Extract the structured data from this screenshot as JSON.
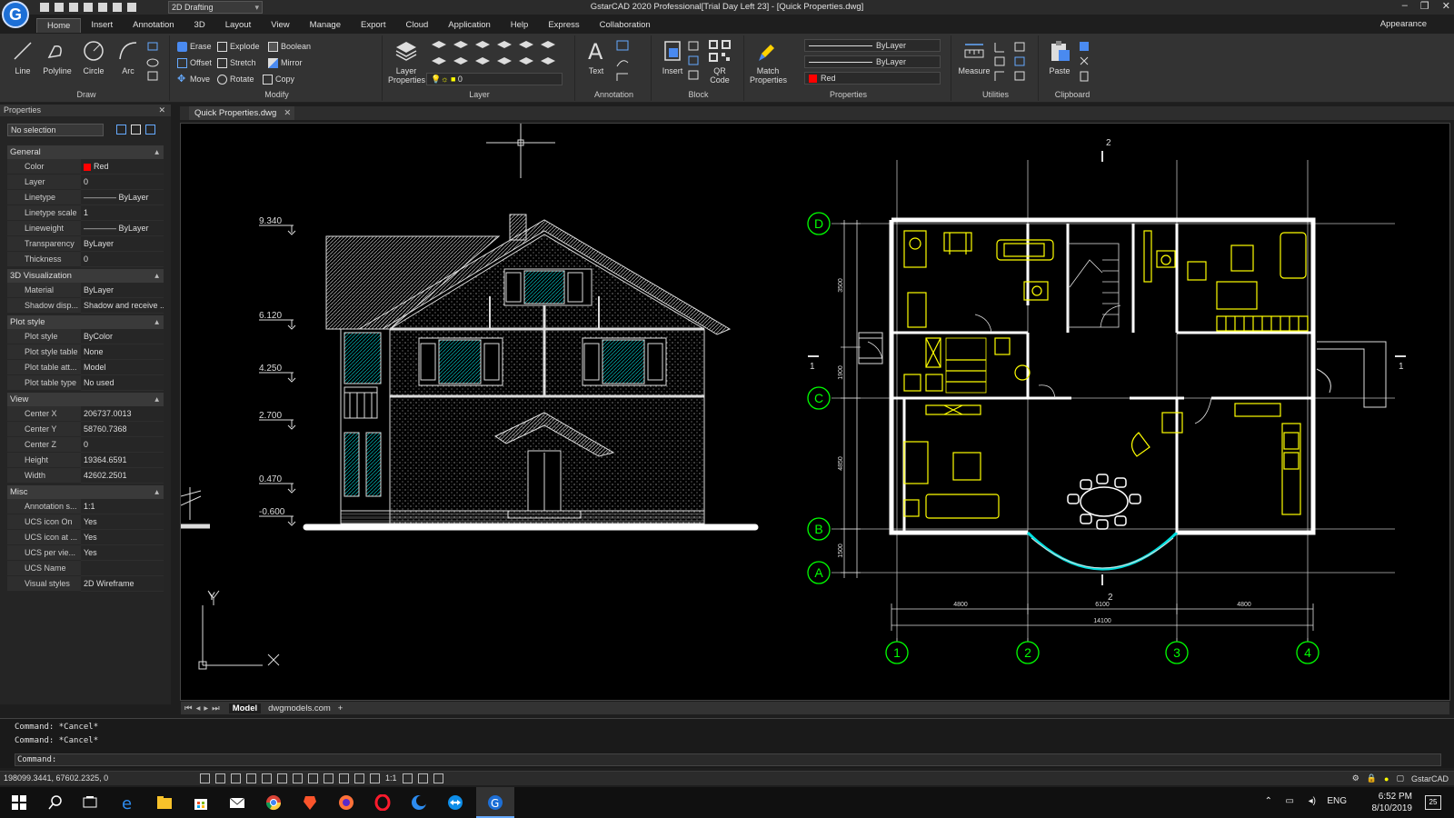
{
  "title_bar": {
    "window_title": "GstarCAD 2020 Professional[Trial Day Left 23] - [Quick Properties.dwg]",
    "workspace": "2D Drafting",
    "logo_letter": "G",
    "controls": [
      "–",
      "❐",
      "✕"
    ]
  },
  "menu": {
    "tabs": [
      "Home",
      "Insert",
      "Annotation",
      "3D",
      "Layout",
      "View",
      "Manage",
      "Export",
      "Cloud",
      "Application",
      "Help",
      "Express",
      "Collaboration"
    ],
    "active": "Home",
    "appearance": "Appearance"
  },
  "ribbon": {
    "draw": {
      "label": "Draw",
      "line": "Line",
      "polyline": "Polyline",
      "circle": "Circle",
      "arc": "Arc"
    },
    "modify": {
      "label": "Modify",
      "erase": "Erase",
      "explode": "Explode",
      "boolean": "Boolean",
      "offset": "Offset",
      "stretch": "Stretch",
      "mirror": "Mirror",
      "move": "Move",
      "rotate": "Rotate",
      "copy": "Copy"
    },
    "layer": {
      "label": "Layer",
      "layer_properties": "Layer Properties",
      "current_layer": "0"
    },
    "annotation": {
      "label": "Annotation",
      "text": "Text"
    },
    "block": {
      "label": "Block",
      "insert": "Insert",
      "qr_code": "QR Code"
    },
    "properties": {
      "label": "Properties",
      "match_properties": "Match Properties",
      "linetype": "ByLayer",
      "lineweight": "ByLayer",
      "color": "Red"
    },
    "utilities": {
      "label": "Utilities",
      "measure": "Measure"
    },
    "clipboard": {
      "label": "Clipboard",
      "paste": "Paste"
    }
  },
  "properties_panel": {
    "title": "Properties",
    "selection": "No selection",
    "sections": [
      {
        "name": "General",
        "rows": [
          {
            "k": "Color",
            "v": "Red"
          },
          {
            "k": "Layer",
            "v": "0"
          },
          {
            "k": "Linetype",
            "v": "———— ByLayer"
          },
          {
            "k": "Linetype scale",
            "v": "1"
          },
          {
            "k": "Lineweight",
            "v": "———— ByLayer"
          },
          {
            "k": "Transparency",
            "v": "ByLayer"
          },
          {
            "k": "Thickness",
            "v": "0"
          }
        ]
      },
      {
        "name": "3D Visualization",
        "rows": [
          {
            "k": "Material",
            "v": "ByLayer"
          },
          {
            "k": "Shadow disp...",
            "v": "Shadow and receive ..."
          }
        ]
      },
      {
        "name": "Plot style",
        "rows": [
          {
            "k": "Plot style",
            "v": "ByColor"
          },
          {
            "k": "Plot style table",
            "v": "None"
          },
          {
            "k": "Plot table att...",
            "v": "Model"
          },
          {
            "k": "Plot table type",
            "v": "No used"
          }
        ]
      },
      {
        "name": "View",
        "rows": [
          {
            "k": "Center X",
            "v": "206737.0013"
          },
          {
            "k": "Center Y",
            "v": "58760.7368"
          },
          {
            "k": "Center Z",
            "v": "0"
          },
          {
            "k": "Height",
            "v": "19364.6591"
          },
          {
            "k": "Width",
            "v": "42602.2501"
          }
        ]
      },
      {
        "name": "Misc",
        "rows": [
          {
            "k": "Annotation s...",
            "v": "1:1"
          },
          {
            "k": "UCS icon On",
            "v": "Yes"
          },
          {
            "k": "UCS icon at ...",
            "v": "Yes"
          },
          {
            "k": "UCS per vie...",
            "v": "Yes"
          },
          {
            "k": "UCS Name",
            "v": ""
          },
          {
            "k": "Visual styles",
            "v": "2D Wireframe"
          }
        ]
      }
    ]
  },
  "document": {
    "tab": "Quick Properties.dwg"
  },
  "drawing": {
    "elevations": [
      "9.340",
      "6.120",
      "4.250",
      "2.700",
      "0.470",
      "-0.600"
    ],
    "row_axes": [
      "D",
      "C",
      "B",
      "A"
    ],
    "col_axes": [
      "1",
      "2",
      "3",
      "4"
    ],
    "dims_bottom": [
      "4800",
      "6100",
      "4800"
    ],
    "dim_total": "14100",
    "dims_left": [
      "3500",
      "1900",
      "4850",
      "1500"
    ],
    "section_marks": [
      "2",
      "2",
      "1",
      "1"
    ],
    "ucs": {
      "y": "Y",
      "x": "X"
    }
  },
  "layout_tabs": [
    "Model",
    "dwgmodels.com"
  ],
  "command": {
    "history": [
      "Command: *Cancel*",
      "Command: *Cancel*"
    ],
    "prompt": "Command:"
  },
  "status": {
    "coords": "198099.3441, 67602.2325, 0",
    "scale": "1:1",
    "product": "GstarCAD"
  },
  "taskbar": {
    "lang": "ENG",
    "time": "6:52 PM",
    "date": "8/10/2019",
    "notifications": "25"
  },
  "colors": {
    "accent": "#1d6fd6",
    "cad_yellow": "#ffff00",
    "cad_green": "#00ff00",
    "cad_cyan": "#00ffff"
  }
}
